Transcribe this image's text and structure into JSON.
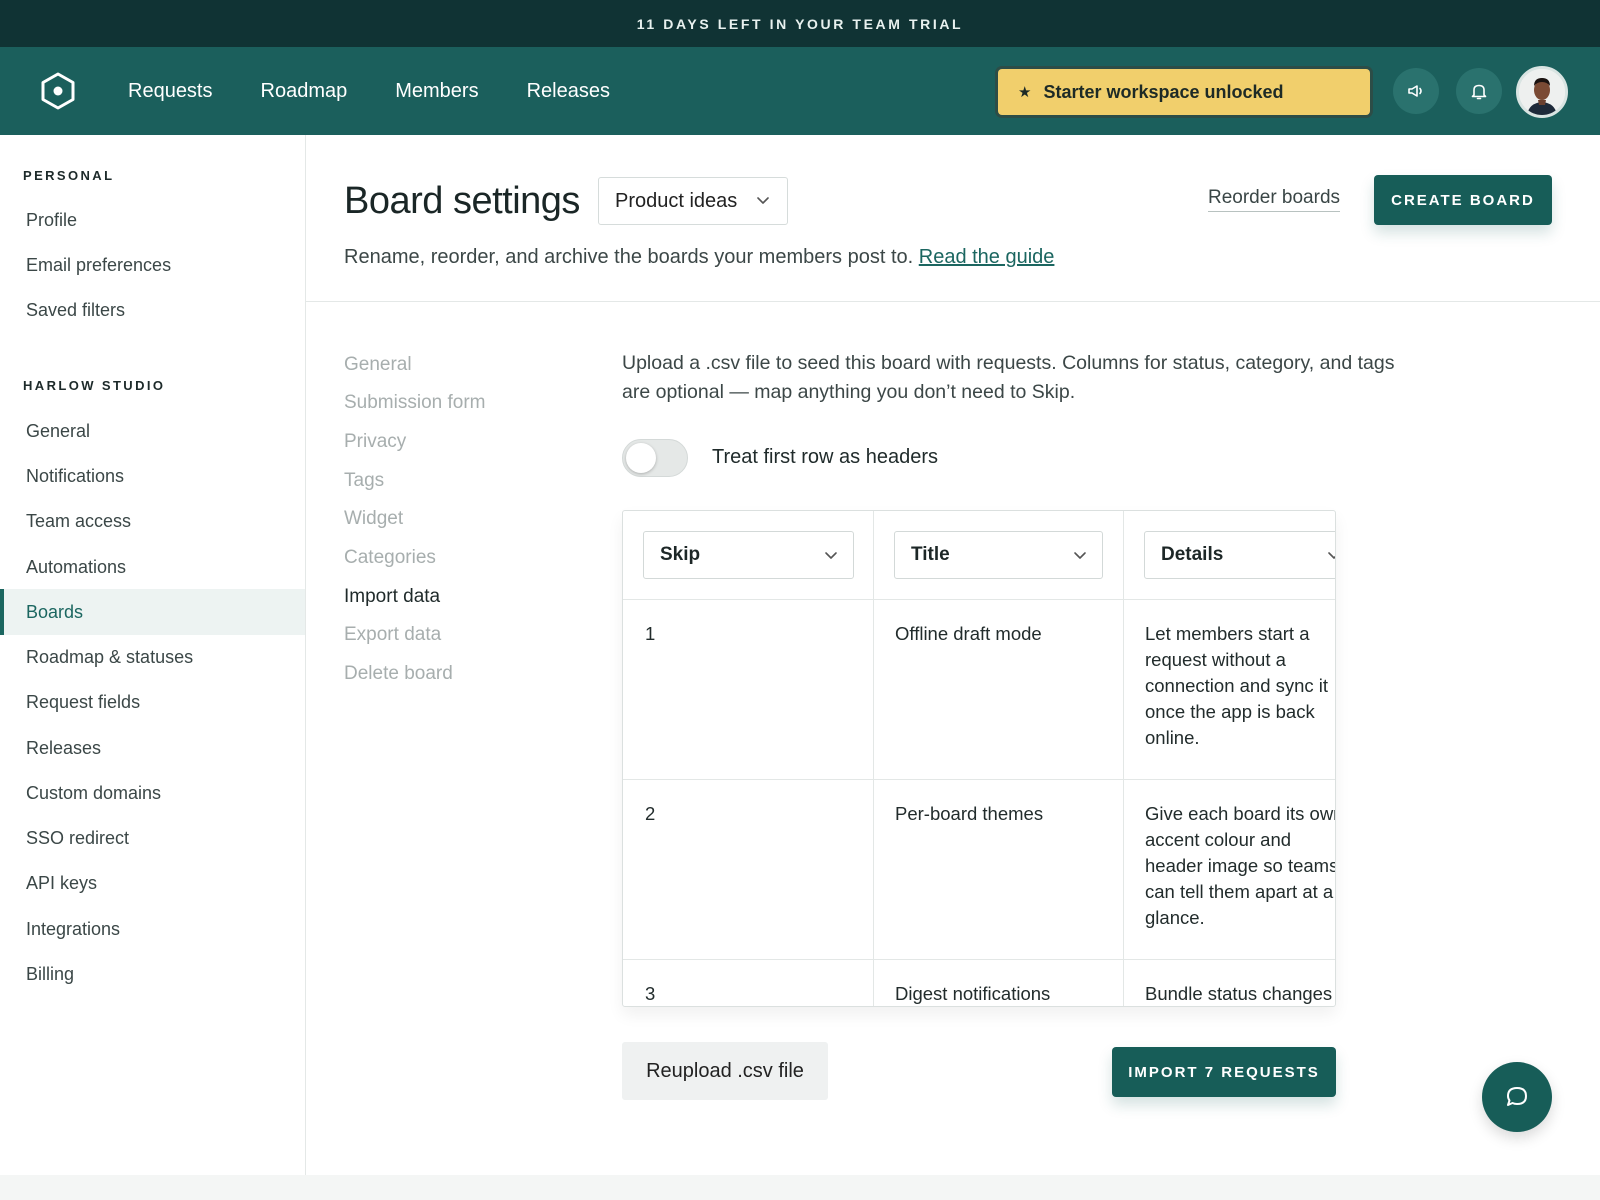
{
  "trial_banner": "11 DAYS LEFT IN YOUR TEAM TRIAL",
  "nav": {
    "logo_icon": "hexagon-logo-icon",
    "links": [
      "Requests",
      "Roadmap",
      "Members",
      "Releases"
    ],
    "promo_label": "Starter workspace unlocked",
    "promo_icon": "star-icon",
    "announce_icon": "megaphone-icon",
    "notify_icon": "bell-icon"
  },
  "sidebar": {
    "personal_heading": "PERSONAL",
    "personal_items": [
      "Profile",
      "Email preferences",
      "Saved filters"
    ],
    "studio_heading": "HARLOW STUDIO",
    "studio_items": [
      "General",
      "Notifications",
      "Team access",
      "Automations",
      "Boards",
      "Roadmap & statuses",
      "Request fields",
      "Releases",
      "Custom domains",
      "SSO redirect",
      "API keys",
      "Integrations",
      "Billing"
    ],
    "active_item": "Boards"
  },
  "header": {
    "title": "Board settings",
    "board_select_value": "Product ideas",
    "reorder_link": "Reorder boards",
    "create_button": "CREATE BOARD",
    "subtitle": "Rename, reorder, and archive the boards your members post to.",
    "guide_link": "Read the guide"
  },
  "subnav": {
    "items": [
      "General",
      "Submission form",
      "Privacy",
      "Tags",
      "Widget",
      "Categories",
      "Import data",
      "Export data",
      "Delete board"
    ],
    "active_item": "Import data"
  },
  "import": {
    "intro": "Upload a .csv file to seed this board with requests. Columns for status, category, and tags are optional — map anything you don’t need to Skip.",
    "toggle_label": "Treat first row as headers",
    "toggle_on": false,
    "columns": [
      "Skip",
      "Title",
      "Details"
    ],
    "rows": [
      {
        "id": "1",
        "title": "Offline draft mode",
        "details": [
          "Let members start a",
          "request without a",
          "connection and sync it",
          "once the app is back",
          "online."
        ]
      },
      {
        "id": "2",
        "title": "Per-board themes",
        "details": [
          "Give each board its own",
          "accent colour and",
          "header image so teams",
          "can tell them apart at a",
          "glance."
        ]
      },
      {
        "id": "3",
        "title": "Digest notifications",
        "details": [
          "Bundle status changes"
        ]
      }
    ],
    "reupload_button": "Reupload .csv file",
    "import_button": "IMPORT 7 REQUESTS"
  },
  "chat_icon": "chat-bubble-icon"
}
